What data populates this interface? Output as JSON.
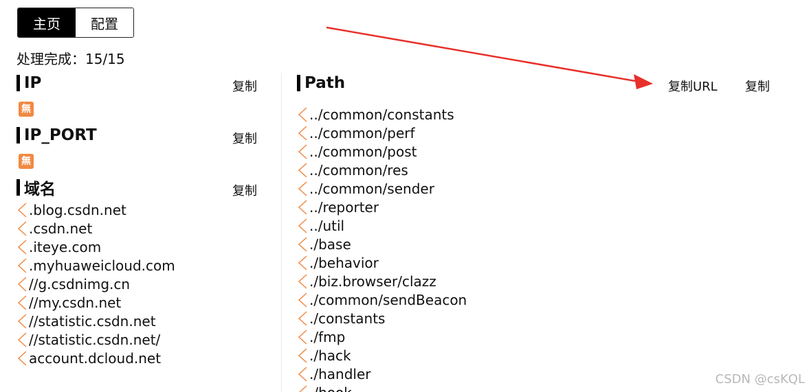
{
  "tabs": [
    {
      "label": "主页",
      "active": true
    },
    {
      "label": "配置",
      "active": false
    }
  ],
  "status": "处理完成：15/15",
  "left": {
    "ip": {
      "title": "IP",
      "copy_label": "复制"
    },
    "ip_port": {
      "title": "IP_PORT",
      "copy_label": "复制"
    },
    "domain": {
      "title": "域名",
      "copy_label": "复制",
      "items": [
        ".blog.csdn.net",
        ".csdn.net",
        ".iteye.com",
        ".myhuaweicloud.com",
        "//g.csdnimg.cn",
        "//my.csdn.net",
        "//statistic.csdn.net",
        "//statistic.csdn.net/",
        "account.dcloud.net"
      ]
    }
  },
  "right": {
    "path": {
      "title": "Path",
      "copy_url_label": "复制URL",
      "copy_label": "复制",
      "items": [
        "../common/constants",
        "../common/perf",
        "../common/post",
        "../common/res",
        "../common/sender",
        "../reporter",
        "../util",
        "./base",
        "./behavior",
        "./biz.browser/clazz",
        "./common/sendBeacon",
        "./constants",
        "./fmp",
        "./hack",
        "./handler",
        "./hook"
      ]
    }
  },
  "empty_icon_glyph": "無",
  "watermark": "CSDN @csKQL",
  "colors": {
    "accent": "#f08a44",
    "arrow": "#e8302a"
  }
}
